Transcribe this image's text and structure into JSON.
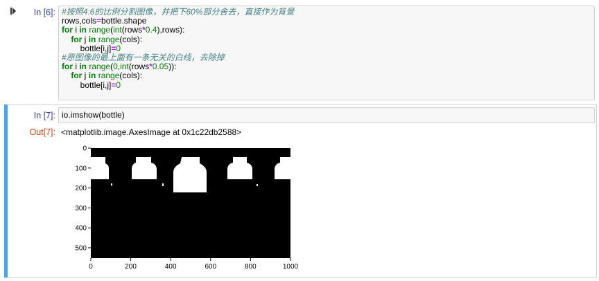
{
  "cells": [
    {
      "prompt": "In [6]:",
      "code_lines": [
        [
          {
            "t": "#按照4:6的比例分割图像，并把下60%部分舍去，直接作为背景",
            "c": "cm"
          }
        ],
        [
          {
            "t": "rows,cols"
          },
          {
            "t": "=",
            "c": "op"
          },
          {
            "t": "bottle.shape"
          }
        ],
        [
          {
            "t": "for",
            "c": "kw"
          },
          {
            "t": " i "
          },
          {
            "t": "in",
            "c": "kw"
          },
          {
            "t": " "
          },
          {
            "t": "range",
            "c": "bi"
          },
          {
            "t": "("
          },
          {
            "t": "int",
            "c": "bi"
          },
          {
            "t": "(rows"
          },
          {
            "t": "*",
            "c": "op"
          },
          {
            "t": "0.4",
            "c": "num"
          },
          {
            "t": "),rows):"
          }
        ],
        [
          {
            "t": "    "
          },
          {
            "t": "for",
            "c": "kw"
          },
          {
            "t": " j "
          },
          {
            "t": "in",
            "c": "kw"
          },
          {
            "t": " "
          },
          {
            "t": "range",
            "c": "bi"
          },
          {
            "t": "(cols):"
          }
        ],
        [
          {
            "t": "        bottle[i,j]"
          },
          {
            "t": "=",
            "c": "op"
          },
          {
            "t": "0",
            "c": "num"
          }
        ],
        [
          {
            "t": "#原图像的最上面有一条无关的白线，去除掉",
            "c": "cm"
          }
        ],
        [
          {
            "t": "for",
            "c": "kw"
          },
          {
            "t": " i "
          },
          {
            "t": "in",
            "c": "kw"
          },
          {
            "t": " "
          },
          {
            "t": "range",
            "c": "bi"
          },
          {
            "t": "("
          },
          {
            "t": "0",
            "c": "num"
          },
          {
            "t": ","
          },
          {
            "t": "int",
            "c": "bi"
          },
          {
            "t": "(rows"
          },
          {
            "t": "*",
            "c": "op"
          },
          {
            "t": "0.05",
            "c": "num"
          },
          {
            "t": ")):"
          }
        ],
        [
          {
            "t": "    "
          },
          {
            "t": "for",
            "c": "kw"
          },
          {
            "t": " j "
          },
          {
            "t": "in",
            "c": "kw"
          },
          {
            "t": " "
          },
          {
            "t": "range",
            "c": "bi"
          },
          {
            "t": "(cols):"
          }
        ],
        [
          {
            "t": "        bottle[i,j]"
          },
          {
            "t": "=",
            "c": "op"
          },
          {
            "t": "0",
            "c": "num"
          }
        ]
      ]
    },
    {
      "prompt": "In [7]:",
      "code_lines": [
        [
          {
            "t": "io.imshow(bottle)"
          }
        ]
      ],
      "output_prompt": "Out[7]:",
      "output_text": "<matplotlib.image.AxesImage at 0x1c22db2588>"
    }
  ],
  "plot": {
    "xticks": [
      "0",
      "200",
      "400",
      "600",
      "800",
      "1000"
    ],
    "yticks": [
      "0",
      "100",
      "200",
      "300",
      "400",
      "500"
    ],
    "image_bg": "#000000",
    "image_fg": "#ffffff"
  },
  "colors": {
    "selected_bar": "#42a5f5",
    "in_prompt": "#303f9f",
    "out_prompt": "#d84315"
  },
  "icons": {
    "run": "bookmark-icon"
  }
}
